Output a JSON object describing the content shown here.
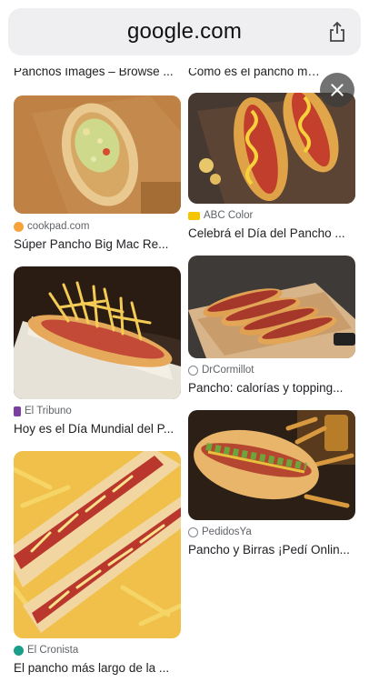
{
  "browser": {
    "url": "google.com",
    "share_icon": "share-icon"
  },
  "overlay": {
    "close_icon": "close-icon"
  },
  "partial_titles": {
    "left": "Panchos Images – Browse ...",
    "right": "Cómo es el pancho más lar..."
  },
  "results_left": [
    {
      "source": "cookpad.com",
      "title": "Súper Pancho Big Mac Re...",
      "source_color": "#f6a33c"
    },
    {
      "source": "El Tribuno",
      "title": "Hoy es el Día Mundial del P...",
      "source_color": "#7b3fa3"
    },
    {
      "source": "El Cronista",
      "title": "El pancho más largo de la ...",
      "source_color": "#1a9d89"
    }
  ],
  "results_right": [
    {
      "source": "ABC Color",
      "title": "Celebrá el Día del Pancho ...",
      "source_color": "#f4c500"
    },
    {
      "source": "DrCormillot",
      "title": "Pancho: calorías y topping...",
      "source_color": "#80868b"
    },
    {
      "source": "PedidosYa",
      "title": "Pancho y Birras ¡Pedí Onlin...",
      "source_color": "#80868b"
    }
  ]
}
